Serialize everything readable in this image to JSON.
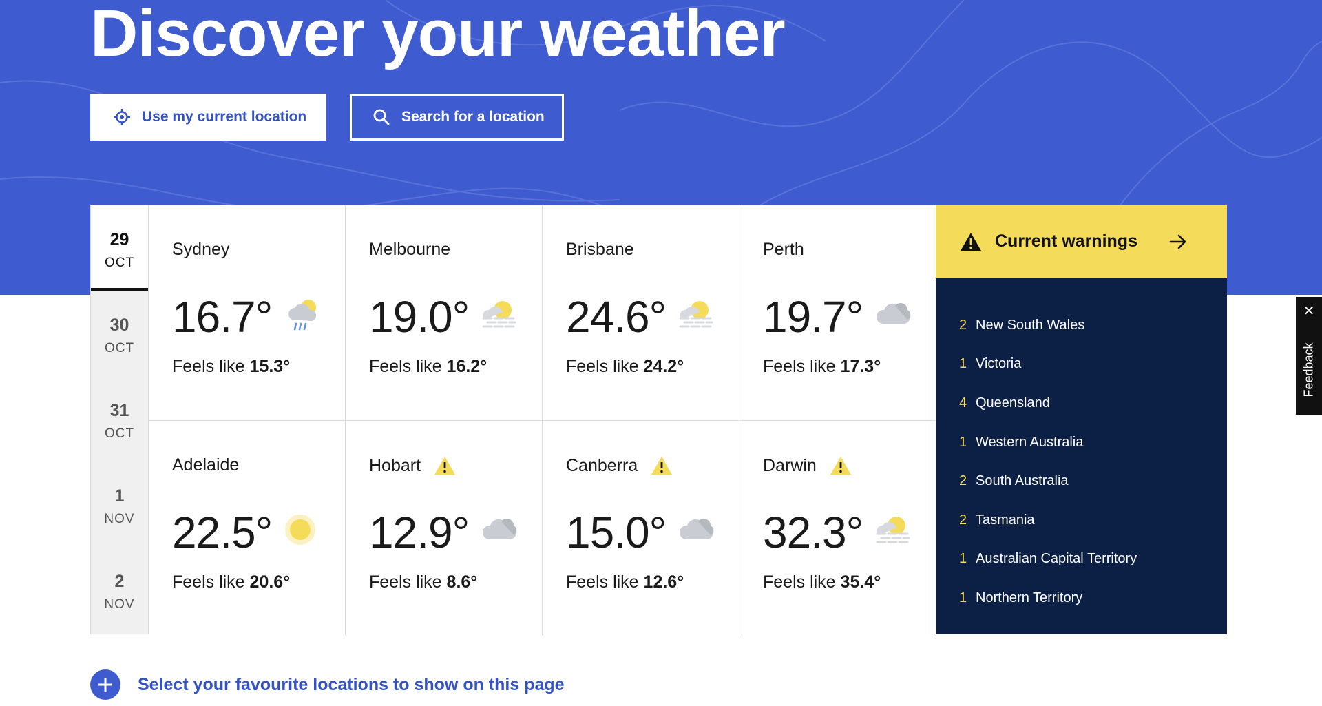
{
  "hero": {
    "title": "Discover your weather",
    "use_location_label": "Use my current location",
    "search_label": "Search for a location"
  },
  "dates": [
    {
      "day": "29",
      "month": "OCT",
      "active": true
    },
    {
      "day": "30",
      "month": "OCT"
    },
    {
      "day": "31",
      "month": "OCT"
    },
    {
      "day": "1",
      "month": "NOV"
    },
    {
      "day": "2",
      "month": "NOV"
    }
  ],
  "cities": [
    {
      "name": "Sydney",
      "temp": "16.7°",
      "feels_label": "Feels like",
      "feels": "15.3°",
      "icon": "rain-sun-cloud-icon",
      "warning": false
    },
    {
      "name": "Melbourne",
      "temp": "19.0°",
      "feels_label": "Feels like",
      "feels": "16.2°",
      "icon": "sun-haze-icon",
      "warning": false
    },
    {
      "name": "Brisbane",
      "temp": "24.6°",
      "feels_label": "Feels like",
      "feels": "24.2°",
      "icon": "sun-haze-icon",
      "warning": false
    },
    {
      "name": "Perth",
      "temp": "19.7°",
      "feels_label": "Feels like",
      "feels": "17.3°",
      "icon": "cloud-icon",
      "warning": false
    },
    {
      "name": "Adelaide",
      "temp": "22.5°",
      "feels_label": "Feels like",
      "feels": "20.6°",
      "icon": "sun-icon",
      "warning": false
    },
    {
      "name": "Hobart",
      "temp": "12.9°",
      "feels_label": "Feels like",
      "feels": "8.6°",
      "icon": "cloud-icon",
      "warning": true
    },
    {
      "name": "Canberra",
      "temp": "15.0°",
      "feels_label": "Feels like",
      "feels": "12.6°",
      "icon": "cloud-icon",
      "warning": true
    },
    {
      "name": "Darwin",
      "temp": "32.3°",
      "feels_label": "Feels like",
      "feels": "35.4°",
      "icon": "sun-haze-icon",
      "warning": true
    }
  ],
  "warnings": {
    "title": "Current warnings",
    "items": [
      {
        "count": "2",
        "region": "New South Wales"
      },
      {
        "count": "1",
        "region": "Victoria"
      },
      {
        "count": "4",
        "region": "Queensland"
      },
      {
        "count": "1",
        "region": "Western Australia"
      },
      {
        "count": "2",
        "region": "South Australia"
      },
      {
        "count": "2",
        "region": "Tasmania"
      },
      {
        "count": "1",
        "region": "Australian Capital Territory"
      },
      {
        "count": "1",
        "region": "Northern Territory"
      }
    ]
  },
  "favourites": {
    "label": "Select your favourite locations to show on this page"
  },
  "feedback": {
    "label": "Feedback",
    "close": "✕"
  },
  "colors": {
    "brand_blue": "#3e5bcf",
    "warning_yellow": "#f4dc5a",
    "navy": "#0c1f44"
  }
}
